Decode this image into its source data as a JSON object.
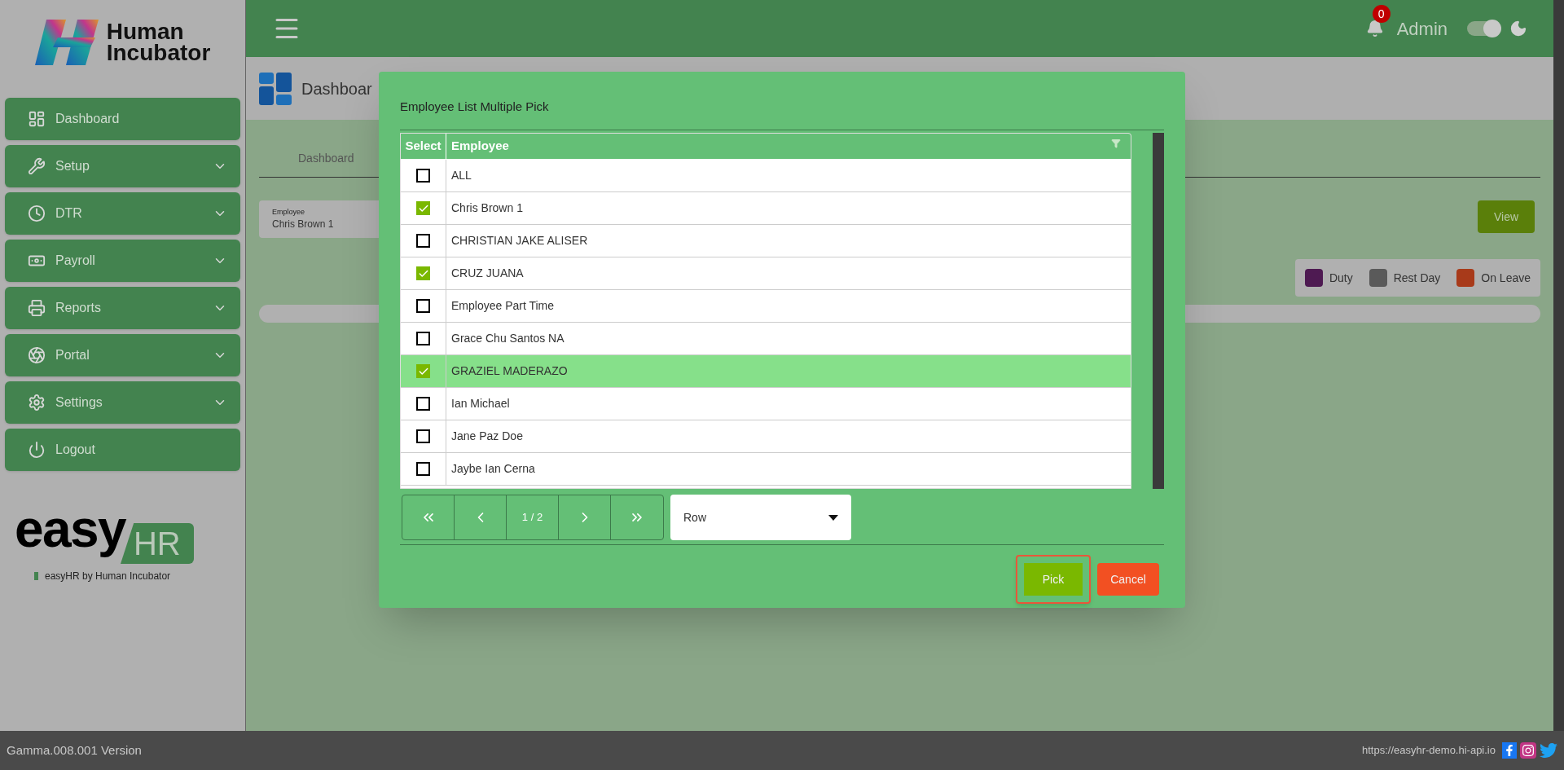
{
  "sidebar": {
    "brand": {
      "line1": "Human",
      "line2": "Incubator"
    },
    "items": [
      {
        "label": "Dashboard",
        "expandable": false
      },
      {
        "label": "Setup",
        "expandable": true
      },
      {
        "label": "DTR",
        "expandable": true
      },
      {
        "label": "Payroll",
        "expandable": true
      },
      {
        "label": "Reports",
        "expandable": true
      },
      {
        "label": "Portal",
        "expandable": true
      },
      {
        "label": "Settings",
        "expandable": true
      },
      {
        "label": "Logout",
        "expandable": false
      }
    ],
    "product_logo": {
      "word": "easy",
      "tag": "HR",
      "tagline": "easyHR by Human Incubator"
    }
  },
  "header": {
    "notification_count": "0",
    "user": "Admin",
    "dark_mode_toggle": {
      "on": true
    }
  },
  "page": {
    "title": "Dashboar",
    "tabs": [
      {
        "label": "Dashboard",
        "selected": true
      }
    ],
    "employee_field": {
      "label": "Employee",
      "value": "Chris  Brown 1"
    },
    "view_button": "View",
    "legend": [
      {
        "label": "Duty",
        "color": "#4e1a52"
      },
      {
        "label": "Rest Day",
        "color": "#5a5a5a"
      },
      {
        "label": "On Leave",
        "color": "#a83a1a"
      }
    ]
  },
  "modal": {
    "title": "Employee List Multiple Pick",
    "table": {
      "columns": [
        "Select",
        "Employee"
      ],
      "rows": [
        {
          "name": "ALL",
          "checked": false,
          "selected": false
        },
        {
          "name": "Chris Brown 1",
          "checked": true,
          "selected": false
        },
        {
          "name": "CHRISTIAN JAKE ALISER",
          "checked": false,
          "selected": false
        },
        {
          "name": "CRUZ JUANA",
          "checked": true,
          "selected": false
        },
        {
          "name": "Employee Part Time",
          "checked": false,
          "selected": false
        },
        {
          "name": "Grace Chu Santos NA",
          "checked": false,
          "selected": false
        },
        {
          "name": "GRAZIEL MADERAZO",
          "checked": true,
          "selected": true
        },
        {
          "name": "Ian Michael",
          "checked": false,
          "selected": false
        },
        {
          "name": "Jane Paz Doe",
          "checked": false,
          "selected": false
        },
        {
          "name": "Jaybe Ian Cerna",
          "checked": false,
          "selected": false
        }
      ]
    },
    "pagination": {
      "page": "1 / 2"
    },
    "rows_select": {
      "value": "Row"
    },
    "buttons": [
      {
        "label": "Pick",
        "kind": "primary",
        "highlighted": true
      },
      {
        "label": "Cancel",
        "kind": "danger",
        "highlighted": false
      }
    ]
  },
  "status_bar": {
    "version": "Gamma.008.001 Version",
    "url": "https://easyhr-demo.hi-api.io"
  }
}
